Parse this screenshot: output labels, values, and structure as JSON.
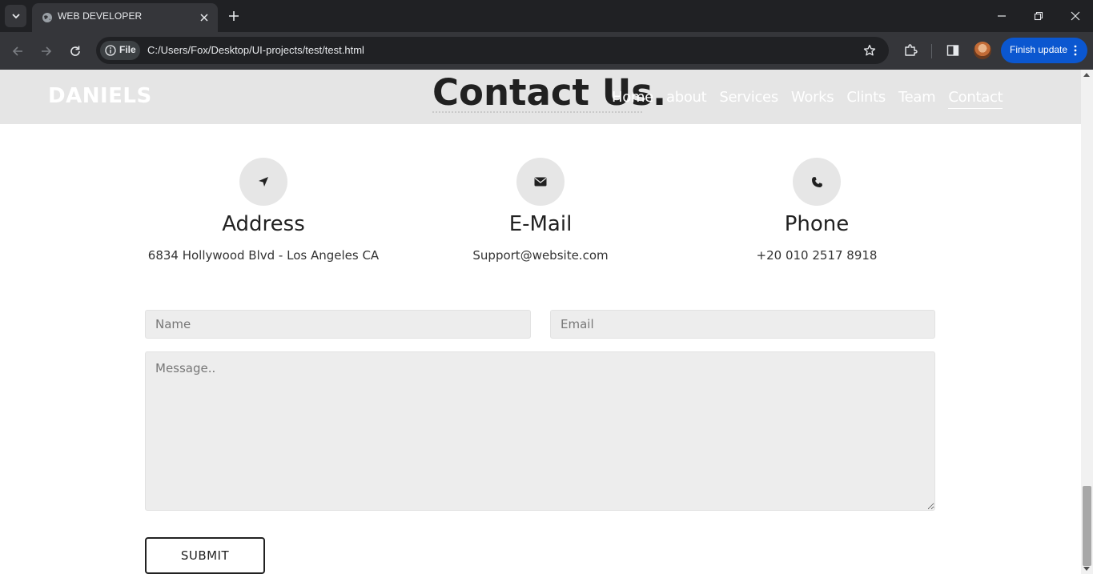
{
  "browser": {
    "tab_title": "WEB DEVELOPER",
    "site_chip_label": "File",
    "url": "C:/Users/Fox/Desktop/UI-projects/test/test.html",
    "update_button_label": "Finish update"
  },
  "site": {
    "logo": "DANIELS",
    "section_title": "Contact Us.",
    "nav": [
      {
        "label": "Home"
      },
      {
        "label": "about"
      },
      {
        "label": "Services"
      },
      {
        "label": "Works"
      },
      {
        "label": "Clints"
      },
      {
        "label": "Team"
      },
      {
        "label": "Contact",
        "active": true
      }
    ]
  },
  "contact_info": [
    {
      "icon": "location-arrow-icon",
      "title": "Address",
      "text": "6834 Hollywood Blvd - Los Angeles CA"
    },
    {
      "icon": "envelope-icon",
      "title": "E-Mail",
      "text": "Support@website.com"
    },
    {
      "icon": "phone-icon",
      "title": "Phone",
      "text": "+20 010 2517 8918"
    }
  ],
  "form": {
    "name_placeholder": "Name",
    "email_placeholder": "Email",
    "message_placeholder": "Message..",
    "submit_label": "SUBMIT"
  },
  "colors": {
    "header_bg": "#e5e5e5",
    "accent_button": "#0b57d0",
    "text_dark": "#212121"
  }
}
